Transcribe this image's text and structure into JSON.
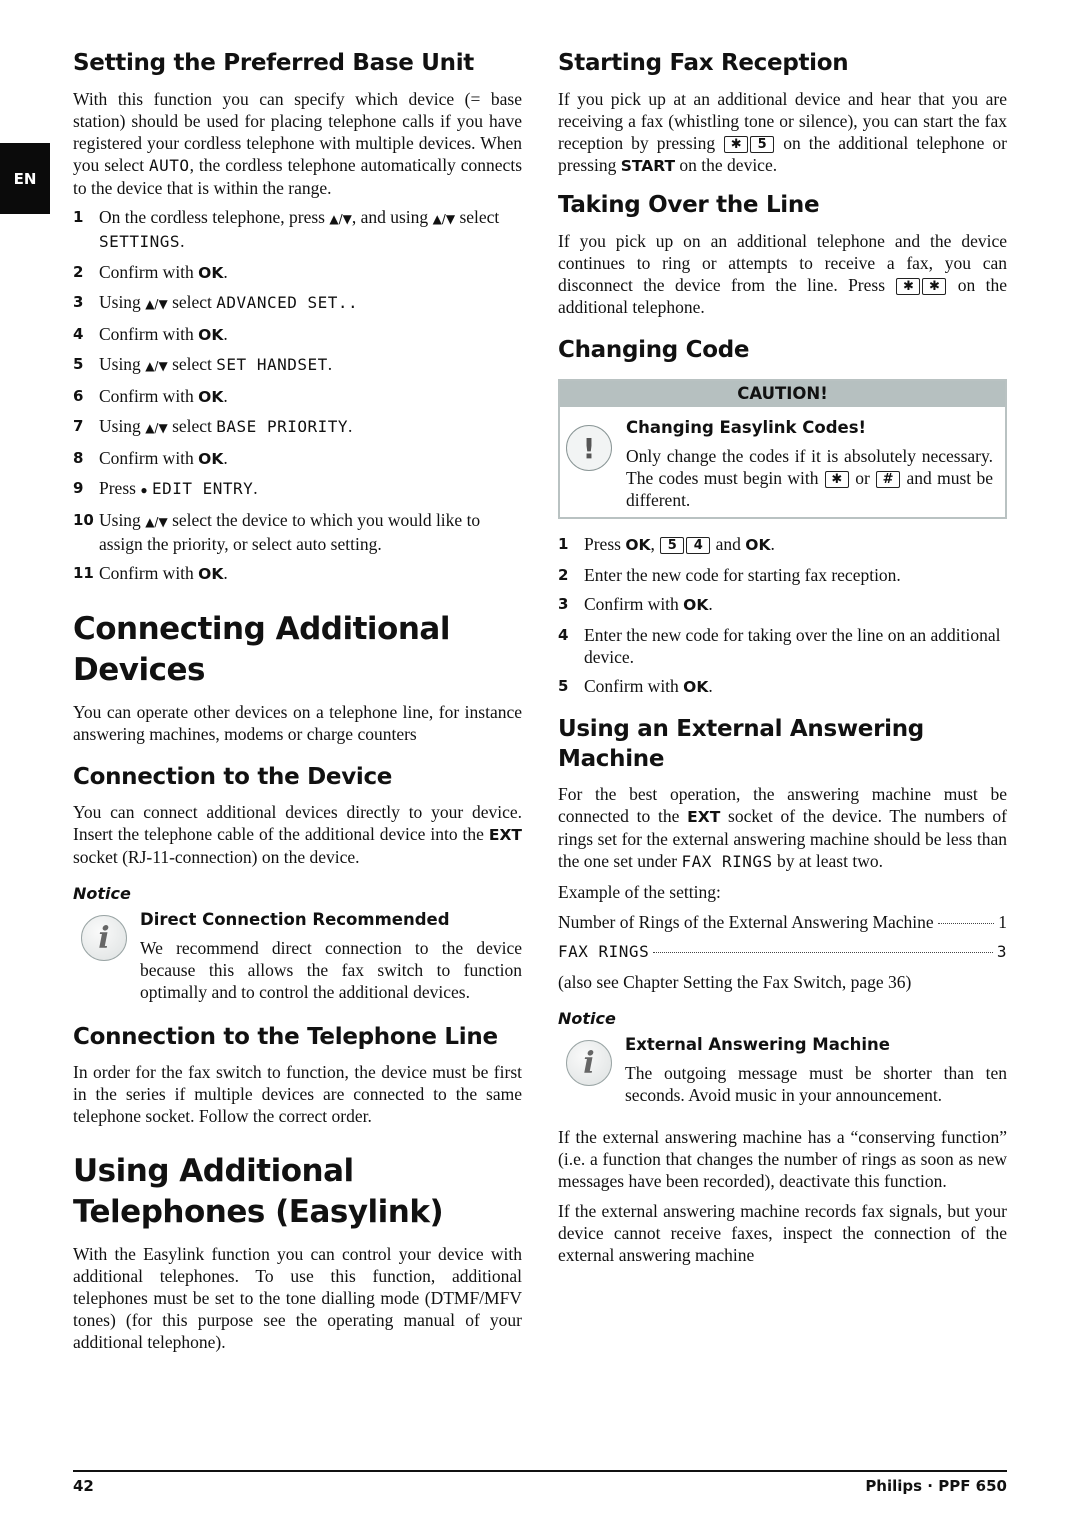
{
  "side_tab": "EN",
  "left": {
    "preferred_base": {
      "heading": "Setting the Preferred Base Unit",
      "intro_a": "With this function you can specify which device (= base station) should be used for placing telephone calls if you have registered your cordless telephone with multiple devices. When you select ",
      "intro_lcd": "AUTO",
      "intro_b": ", the cordless telephone automatically connects to the device that is within the range.",
      "steps": [
        {
          "num": "1",
          "pre": "On the cordless telephone, press ",
          "arrows1": "▲/▼",
          "mid": ", and using ",
          "arrows2": "▲/▼",
          "post": " select ",
          "lcd": "SETTINGS",
          "end": "."
        },
        {
          "num": "2",
          "pre": "Confirm with ",
          "bold": "OK",
          "end": "."
        },
        {
          "num": "3",
          "pre": "Using ",
          "arrows1": "▲/▼",
          "post": " select ",
          "lcd": "ADVANCED SET..",
          "end": ""
        },
        {
          "num": "4",
          "pre": "Confirm with ",
          "bold": "OK",
          "end": "."
        },
        {
          "num": "5",
          "pre": "Using ",
          "arrows1": "▲/▼",
          "post": " select ",
          "lcd": "SET HANDSET",
          "end": "."
        },
        {
          "num": "6",
          "pre": "Confirm with ",
          "bold": "OK",
          "end": "."
        },
        {
          "num": "7",
          "pre": "Using ",
          "arrows1": "▲/▼",
          "post": " select ",
          "lcd": "BASE PRIORITY",
          "end": "."
        },
        {
          "num": "8",
          "pre": "Confirm with ",
          "bold": "OK",
          "end": "."
        },
        {
          "num": "9",
          "pre": "Press ",
          "bullet": "●",
          "lcd": "EDIT ENTRY",
          "end": "."
        },
        {
          "num": "10",
          "pre": "Using ",
          "arrows1": "▲/▼",
          "post": " select the device to which you would like to assign the priority, or select auto setting."
        },
        {
          "num": "11",
          "pre": "Confirm with ",
          "bold": "OK",
          "end": "."
        }
      ]
    },
    "connecting": {
      "heading": "Connecting Additional Devices",
      "text": "You can operate other devices on a telephone line, for instance answering machines, modems or charge counters"
    },
    "connection_device": {
      "heading": "Connection to the Device",
      "text_a": "You can connect additional devices directly to your device. Insert the telephone cable of the additional device into the ",
      "bold": "EXT",
      "text_b": " socket (RJ-11-connection) on the device.",
      "notice_label": "Notice",
      "notice_title": "Direct Connection Recommended",
      "notice_text": "We recommend direct connection to the device because this allows the fax switch to function optimally and to control the additional devices."
    },
    "connection_line": {
      "heading": "Connection to the Telephone Line",
      "text": "In order for the fax switch to function, the device must be first in the series if multiple devices are connected to the same telephone socket. Follow the correct order."
    },
    "easylink": {
      "heading": "Using Additional Telephones (Easylink)",
      "text": "With the Easylink function you can control your device with additional telephones. To use this function, additional telephones must be set to the tone dialling mode (DTMF/MFV tones) (for this purpose see the operating manual of your additional telephone)."
    }
  },
  "right": {
    "fax_reception": {
      "heading": "Starting Fax Reception",
      "text_a": "If you pick up at an additional device and hear that you are receiving a fax (whistling tone or silence), you can start the fax reception by pressing ",
      "keys": [
        "✱",
        "5"
      ],
      "text_b": " on the additional telephone or pressing ",
      "bold": "START",
      "text_c": " on the device."
    },
    "taking_over": {
      "heading": "Taking Over the Line",
      "text_a": "If you pick up on an additional telephone and the device continues to ring or attempts to receive a fax, you can disconnect the device from the line.  Press ",
      "keys": [
        "✱",
        "✱"
      ],
      "text_b": " on the additional telephone."
    },
    "changing_code": {
      "heading": "Changing Code",
      "caution_label": "CAUTION!",
      "caution_title": "Changing Easylink Codes!",
      "caution_text_a": "Only change the codes if it is absolutely necessary. The codes must begin with ",
      "caution_key1": "✱",
      "caution_or": " or ",
      "caution_key2": "#",
      "caution_text_b": " and must be different.",
      "steps": [
        {
          "num": "1",
          "pre": "Press ",
          "bold": "OK",
          "mid": ", ",
          "keys": [
            "5",
            "4"
          ],
          "post": " and ",
          "bold2": "OK",
          "end": "."
        },
        {
          "num": "2",
          "text": "Enter the new code for starting fax reception."
        },
        {
          "num": "3",
          "pre": "Confirm with ",
          "bold": "OK",
          "end": "."
        },
        {
          "num": "4",
          "text": "Enter the new code for taking over the line on an additional device."
        },
        {
          "num": "5",
          "pre": "Confirm with ",
          "bold": "OK",
          "end": "."
        }
      ]
    },
    "answering_machine": {
      "heading": "Using an External Answering Machine",
      "text_a": "For the best operation, the answering machine must be connected to the ",
      "bold": "EXT",
      "text_b": " socket of the device. The numbers of rings set for the external answering machine should be less than the one set under ",
      "lcd": "FAX RINGS",
      "text_c": " by at least two.",
      "example_label": "Example of the setting:",
      "row1_label": "Number of Rings of the External Answering Machine",
      "row1_value": "1",
      "row2_label": "FAX RINGS",
      "row2_value": "3",
      "see_also": "(also see Chapter Setting the Fax Switch, page 36)",
      "notice_label": "Notice",
      "notice_title": "External Answering Machine",
      "notice_text": "The outgoing message must be shorter than ten seconds. Avoid music in your announcement.",
      "para2": "If the external answering machine has a “conserving function” (i.e. a function that changes the number of rings as soon as new messages have been recorded), deactivate this function.",
      "para3": "If the external answering machine records fax signals, but your device cannot receive faxes, inspect the connection of the external answering machine"
    }
  },
  "footer": {
    "page_number": "42",
    "product": "Philips · PPF 650"
  }
}
